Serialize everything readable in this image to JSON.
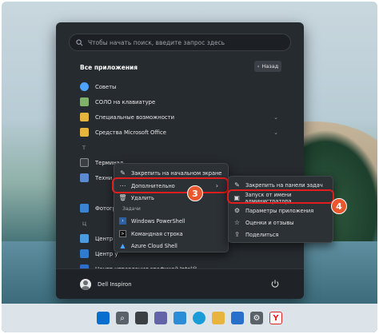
{
  "search": {
    "placeholder": "Чтобы начать поиск, введите запрос здесь"
  },
  "all_apps": {
    "title": "Все приложения",
    "back_label": "Назад"
  },
  "apps": [
    {
      "label": "Советы",
      "icon": "tips-icon",
      "color": "#4ea3ff",
      "chevron": false
    },
    {
      "label": "СОЛО на клавиатуре",
      "icon": "solo-icon",
      "color": "#7fb36a",
      "chevron": false
    },
    {
      "label": "Специальные возможности",
      "icon": "folder-icon",
      "color": "#e7b53d",
      "chevron": true
    },
    {
      "label": "Средства Microsoft Office",
      "icon": "folder-icon",
      "color": "#e7b53d",
      "chevron": true
    }
  ],
  "letter_t": "Т",
  "terminal_label": "Терминал",
  "technical_label": "Техни",
  "photos_label": "Фотогр",
  "letter_ts": "Ц",
  "center1_label": "Центр с",
  "center2_label": "Центр у",
  "graphics_label": "Центр управления графикой Intel®",
  "user": {
    "name": "Dell Inspiron"
  },
  "context_menu": {
    "pin_start": "Закрепить на начальном экране",
    "more": "Дополнительно",
    "uninstall": "Удалить",
    "tasks_header": "Задачи",
    "powershell": "Windows PowerShell",
    "cmd": "Командная строка",
    "azure": "Azure Cloud Shell"
  },
  "submenu": {
    "pin_taskbar": "Закрепить на панели задач",
    "run_admin": "Запуск от имени администратора",
    "app_settings": "Параметры приложения",
    "rate": "Оценки и отзывы",
    "share": "Поделиться"
  },
  "badges": {
    "step3": "3",
    "step4": "4"
  },
  "colors": {
    "highlight": "#e11d1d",
    "badge": "#e9572d"
  },
  "taskbar_icons": [
    "windows-icon",
    "search-icon",
    "task-view-icon",
    "chat-icon",
    "widgets-icon",
    "edge-icon",
    "explorer-icon",
    "store-icon",
    "settings-icon",
    "yandex-icon"
  ]
}
